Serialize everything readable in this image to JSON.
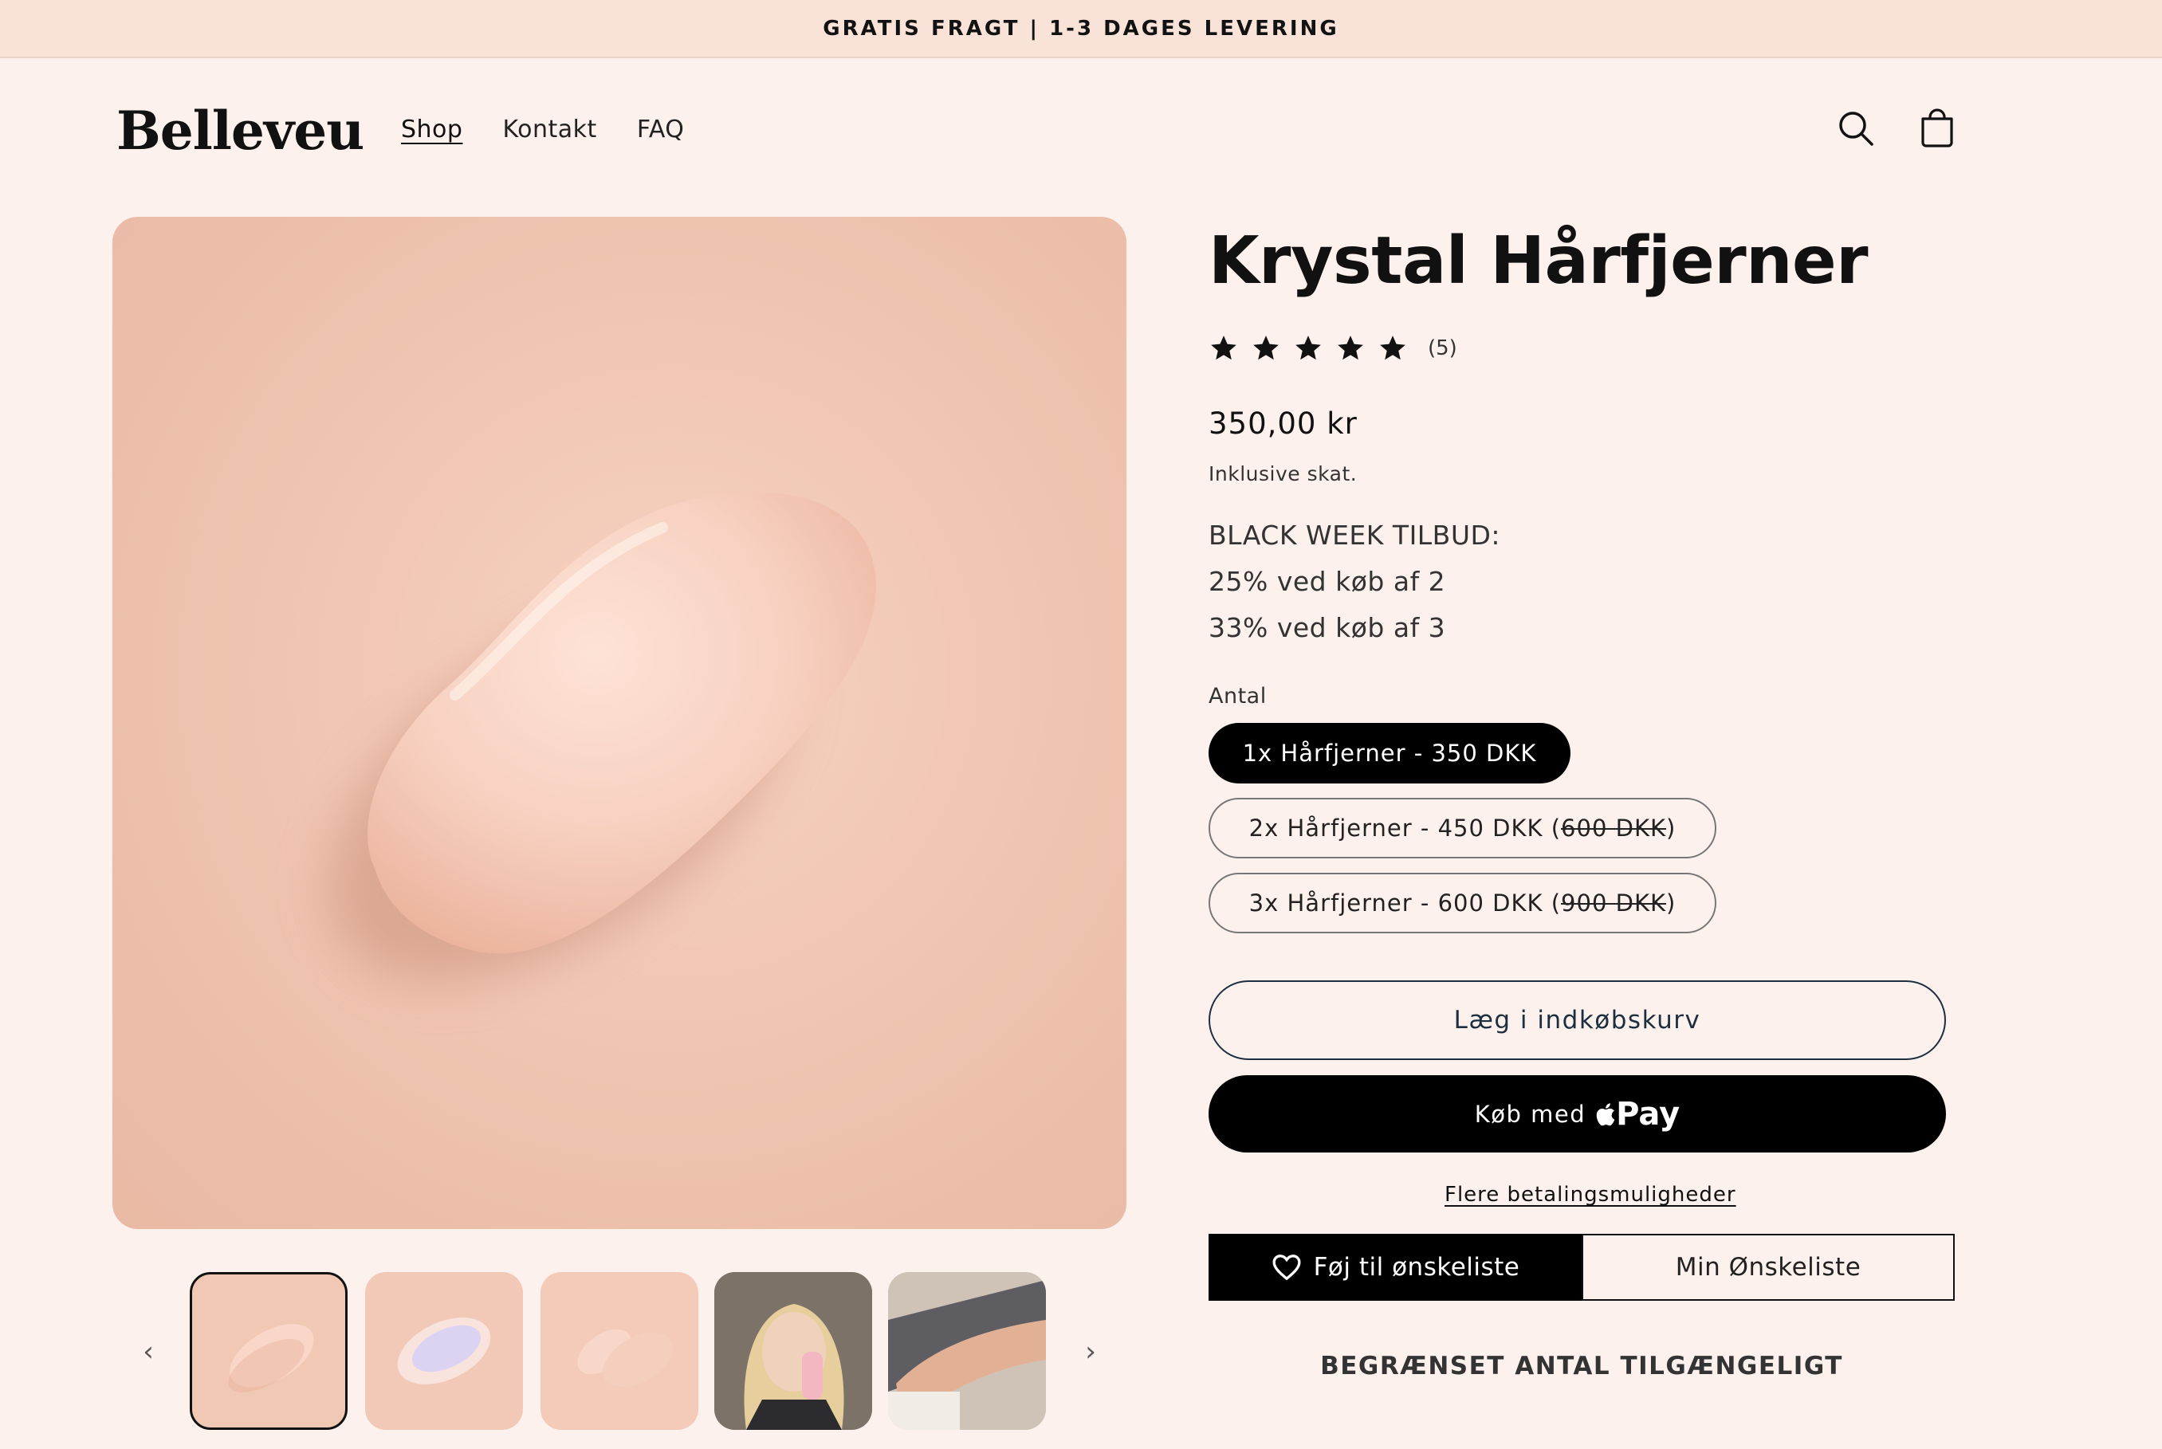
{
  "announcement": "GRATIS FRAGT | 1-3 DAGES LEVERING",
  "header": {
    "logo": "Belleveu",
    "nav": [
      {
        "label": "Shop",
        "active": true
      },
      {
        "label": "Kontakt",
        "active": false
      },
      {
        "label": "FAQ",
        "active": false
      }
    ],
    "icons": [
      "search-icon",
      "cart-icon"
    ]
  },
  "product": {
    "title": "Krystal Hårfjerner",
    "rating": {
      "stars": 5,
      "count": "(5)"
    },
    "price": "350,00 kr",
    "tax_note": "Inklusive skat.",
    "promo": {
      "heading": "BLACK WEEK TILBUD:",
      "line1": "25% ved køb af 2",
      "line2": "33% ved køb af 3"
    },
    "quantity_label": "Antal",
    "options": [
      {
        "label": "1x Hårfjerner - 350 DKK",
        "selected": true
      },
      {
        "label": "2x Hårfjerner - 450 DKK (",
        "strike": "600 DKK",
        "suffix": ")",
        "selected": false
      },
      {
        "label": "3x Hårfjerner - 600 DKK (",
        "strike": "900 DKK",
        "suffix": ")",
        "selected": false
      }
    ],
    "add_to_cart": "Læg i indkøbskurv",
    "buy_now_prefix": "Køb med",
    "buy_now_brand": "Pay",
    "more_payment": "Flere betalingsmuligheder",
    "wishlist_add": "Føj til ønskeliste",
    "wishlist_my": "Min Ønskeliste",
    "limited": "BEGRÆNSET ANTAL TILGÆNGELIGT"
  },
  "gallery": {
    "thumbnails": [
      "thumb-1",
      "thumb-2",
      "thumb-3",
      "thumb-4",
      "thumb-5"
    ],
    "active_index": 0
  },
  "colors": {
    "background": "#fcf1ec",
    "announcement_bg": "#f9e3d8",
    "accent": "#000000",
    "product_pink": "#f4c9b6"
  }
}
